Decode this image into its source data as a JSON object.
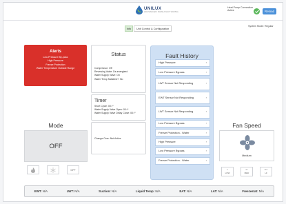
{
  "header": {
    "brand": "UNILUX",
    "brand_sub": "ADVANCED MANUFACTURING",
    "hp_connection_line1": "Heat Pump Connection",
    "hp_connection_line2": "Active",
    "reload_label": "Reload"
  },
  "tabs": [
    {
      "label": "Info",
      "active": true
    },
    {
      "label": "Unit Control & Configuration",
      "active": false
    }
  ],
  "system_mode": "System Mode: Regular",
  "alerts": {
    "title": "Alerts",
    "items": [
      "Low Pressure By-pass",
      "High Pressure",
      "Freeze Protection",
      "Water Temperature Outside Range"
    ]
  },
  "status": {
    "title": "Status",
    "lines": [
      "Compressor: Off",
      "Reversing Valve: De-energized",
      "Water Supply Valve: On",
      "Water Temp Satisfied?: No"
    ],
    "timer_title": "Timer",
    "timer_lines": [
      "Short Cycle: 00:¹⁰",
      "Water Supply Valve Open: 00:¹⁰",
      "Water Supply Valve Delay Close: 00:¹⁰"
    ],
    "change_over": "Change Over: Not Active"
  },
  "fault_history": {
    "title": "Fault History",
    "items": [
      {
        "label": "High Pressure",
        "tall": false
      },
      {
        "label": "Low Pressure Bypass",
        "tall": false
      },
      {
        "label": "LWT Sensor Not Responding",
        "tall": true
      },
      {
        "label": "EWT Sensor Not Responding",
        "tall": true
      },
      {
        "label": "LWT Sensor Not Responding",
        "tall": true
      },
      {
        "label": "Low Pressure Bypass",
        "tall": false
      },
      {
        "label": "Freeze Protection - Water",
        "tall": false
      },
      {
        "label": "High Pressure",
        "tall": false
      },
      {
        "label": "Low Pressure Bypass",
        "tall": false
      },
      {
        "label": "Freeze Protection - Water",
        "tall": false
      }
    ],
    "arrow": "›"
  },
  "mode": {
    "title": "Mode",
    "value": "OFF",
    "buttons": {
      "heat_icon": "flame-icon",
      "cool_icon": "snowflake-icon",
      "off_label": "OFF"
    }
  },
  "fan": {
    "title": "Fan Speed",
    "value": "Medium",
    "buttons": [
      {
        "dots": "•",
        "label": "LOW"
      },
      {
        "dots": "••",
        "label": "MED"
      },
      {
        "dots": "•••",
        "label": "HI"
      }
    ]
  },
  "readings": [
    {
      "label": "EWT:",
      "value": "N/A"
    },
    {
      "label": "LWT:",
      "value": "N/A"
    },
    {
      "label": "Suction:",
      "value": "N/A"
    },
    {
      "label": "Liquid Temp:",
      "value": "N/A"
    },
    {
      "label": "EAT:",
      "value": "N/A"
    },
    {
      "label": "LAT:",
      "value": "N/A"
    },
    {
      "label": "Freezestat:",
      "value": "N/A"
    }
  ],
  "colors": {
    "alert": "#d9302a",
    "ok": "#5cb85c",
    "accent": "#4a90d9",
    "fault_panel": "#cfe0f4"
  }
}
